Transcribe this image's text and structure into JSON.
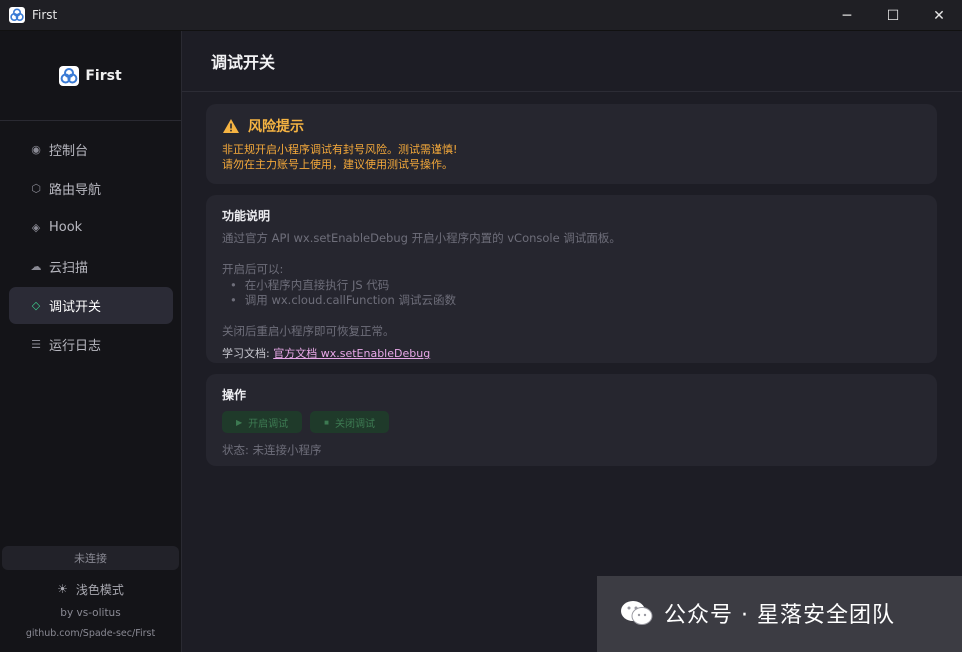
{
  "window": {
    "title": "First",
    "controls": {
      "minimize": "─",
      "maximize": "☐",
      "close": "✕"
    }
  },
  "sidebar": {
    "brand": "First",
    "items": [
      {
        "label": "控制台",
        "icon": "dot-icon",
        "glyph": "◉"
      },
      {
        "label": "路由导航",
        "icon": "hexagon-icon",
        "glyph": "⬡"
      },
      {
        "label": "Hook",
        "icon": "diamond-icon",
        "glyph": "◈"
      },
      {
        "label": "云扫描",
        "icon": "cloud-icon",
        "glyph": "☁"
      },
      {
        "label": "调试开关",
        "icon": "diamond-outline-icon",
        "glyph": "◇",
        "active": true
      },
      {
        "label": "运行日志",
        "icon": "list-icon",
        "glyph": "☰"
      }
    ],
    "connection_status": "未连接",
    "theme_toggle": {
      "icon": "sun-icon",
      "glyph": "☀",
      "label": "浅色模式"
    },
    "author": "by vs-olitus",
    "repo": "github.com/Spade-sec/First"
  },
  "main": {
    "title": "调试开关",
    "warning": {
      "title": "风险提示",
      "line1": "非正规开启小程序调试有封号风险。测试需谨慎!",
      "line2": "请勿在主力账号上使用，建议使用测试号操作。"
    },
    "function": {
      "title": "功能说明",
      "desc": "通过官方 API wx.setEnableDebug 开启小程序内置的 vConsole 调试面板。",
      "after_enable": "开启后可以:",
      "items": [
        "在小程序内直接执行 JS 代码",
        "调用 wx.cloud.callFunction 调试云函数"
      ],
      "restore": "关闭后重启小程序即可恢复正常。",
      "doc_label": "学习文档:",
      "doc_link": "官方文档 wx.setEnableDebug"
    },
    "operation": {
      "title": "操作",
      "enable_button": "开启调试",
      "disable_button": "关闭调试",
      "status": "状态: 未连接小程序"
    }
  },
  "watermark": {
    "text": "公众号 · 星落安全团队"
  },
  "colors": {
    "accent": "#3ecf8e",
    "warning": "#f5b342",
    "link": "#e8a8e8"
  }
}
